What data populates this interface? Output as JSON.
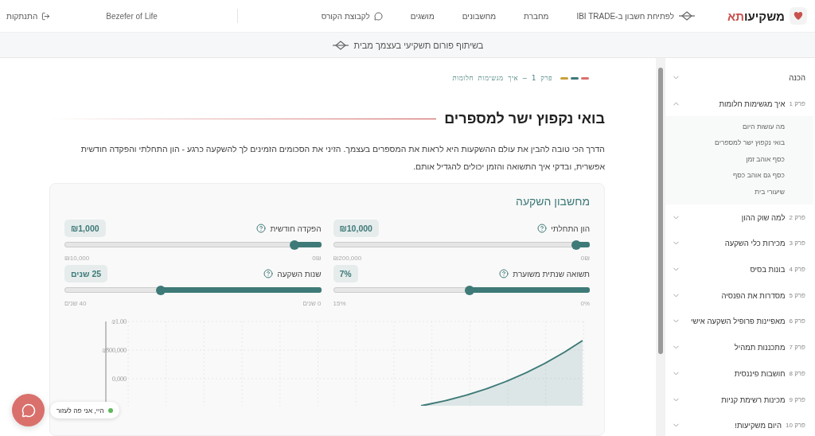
{
  "header": {
    "brand": {
      "text": "משקיעו",
      "accent": "תא"
    },
    "nav": [
      {
        "kind": "partner",
        "label": "לפתיחת חשבון ב-IBI TRADE"
      },
      {
        "kind": "plain",
        "label": "מחברת"
      },
      {
        "kind": "plain",
        "label": "מחשבונים"
      },
      {
        "kind": "plain",
        "label": "מושגים"
      },
      {
        "kind": "chat",
        "label": "לקבוצת הקורס"
      }
    ],
    "user": "Bezefer of Life",
    "logout": "התנתקות"
  },
  "banner": {
    "text": "בשיתוף פורום תשקיעי בעצמך מבית"
  },
  "breadcrumb": "פרק 1 — איך מגשימות חלומות",
  "heading": "בואי נקפוץ ישר למספרים",
  "intro": "הדרך הכי טובה להבין את עולם ההשקעות היא לראות את המספרים בעצמך. הזיני את הסכומים הזמינים לך להשקעה כרגע - הון התחלתי והפקדה חודשית אפשרית, ובדקי איך התשואה והזמן יכולים להגדיל אותם.",
  "calculator": {
    "title": "מחשבון השקעה",
    "sliders": [
      {
        "label": "הון התחלתי",
        "value": "₪10,000",
        "level": 0.05,
        "min": "0₪",
        "max": "₪200,000"
      },
      {
        "label": "הפקדה חודשית",
        "value": "₪1,000",
        "level": 0.1,
        "min": "0₪",
        "max": "₪10,000"
      },
      {
        "label": "תשואה שנתית משוערת",
        "value": "7%",
        "level": 0.467,
        "min": "0%",
        "max": "15%"
      },
      {
        "label": "שנות השקעה",
        "value": "25 שנים",
        "level": 0.625,
        "min": "0 שנים",
        "max": "40 שנים"
      }
    ],
    "chart": {
      "y_labels": [
        "₪1.00",
        "₪800,000",
        "0,000"
      ]
    }
  },
  "sidebar": [
    {
      "label": "הכנה",
      "expanded": false
    },
    {
      "prefix": "פרק 1",
      "label": "איך מגשימות חלומות",
      "expanded": true,
      "children": [
        "מה עושות היום",
        "בואי נקפוץ ישר למספרים",
        "כסף אוהב זמן",
        "כסף גם אוהב כסף",
        "שיעורי בית"
      ]
    },
    {
      "prefix": "פרק 2",
      "label": "למה שוק ההון",
      "expanded": false
    },
    {
      "prefix": "פרק 3",
      "label": "מכירות כלי השקעה",
      "expanded": false
    },
    {
      "prefix": "פרק 4",
      "label": "בונות בסיס",
      "expanded": false
    },
    {
      "prefix": "פרק 5",
      "label": "מסדרות את הפנסיה",
      "expanded": false
    },
    {
      "prefix": "פרק 6",
      "label": "מאפיינות פרופיל השקעה אישי",
      "expanded": false
    },
    {
      "prefix": "פרק 7",
      "label": "מתכננות תמהיל",
      "expanded": false
    },
    {
      "prefix": "פרק 8",
      "label": "חושבות פיננסית",
      "expanded": false
    },
    {
      "prefix": "פרק 9",
      "label": "מכינות רשימת קניות",
      "expanded": false
    },
    {
      "prefix": "פרק 10",
      "label": "היום משקיעות!",
      "expanded": false
    }
  ],
  "chat": {
    "greeting": "היי, אני פה לעזור"
  }
}
